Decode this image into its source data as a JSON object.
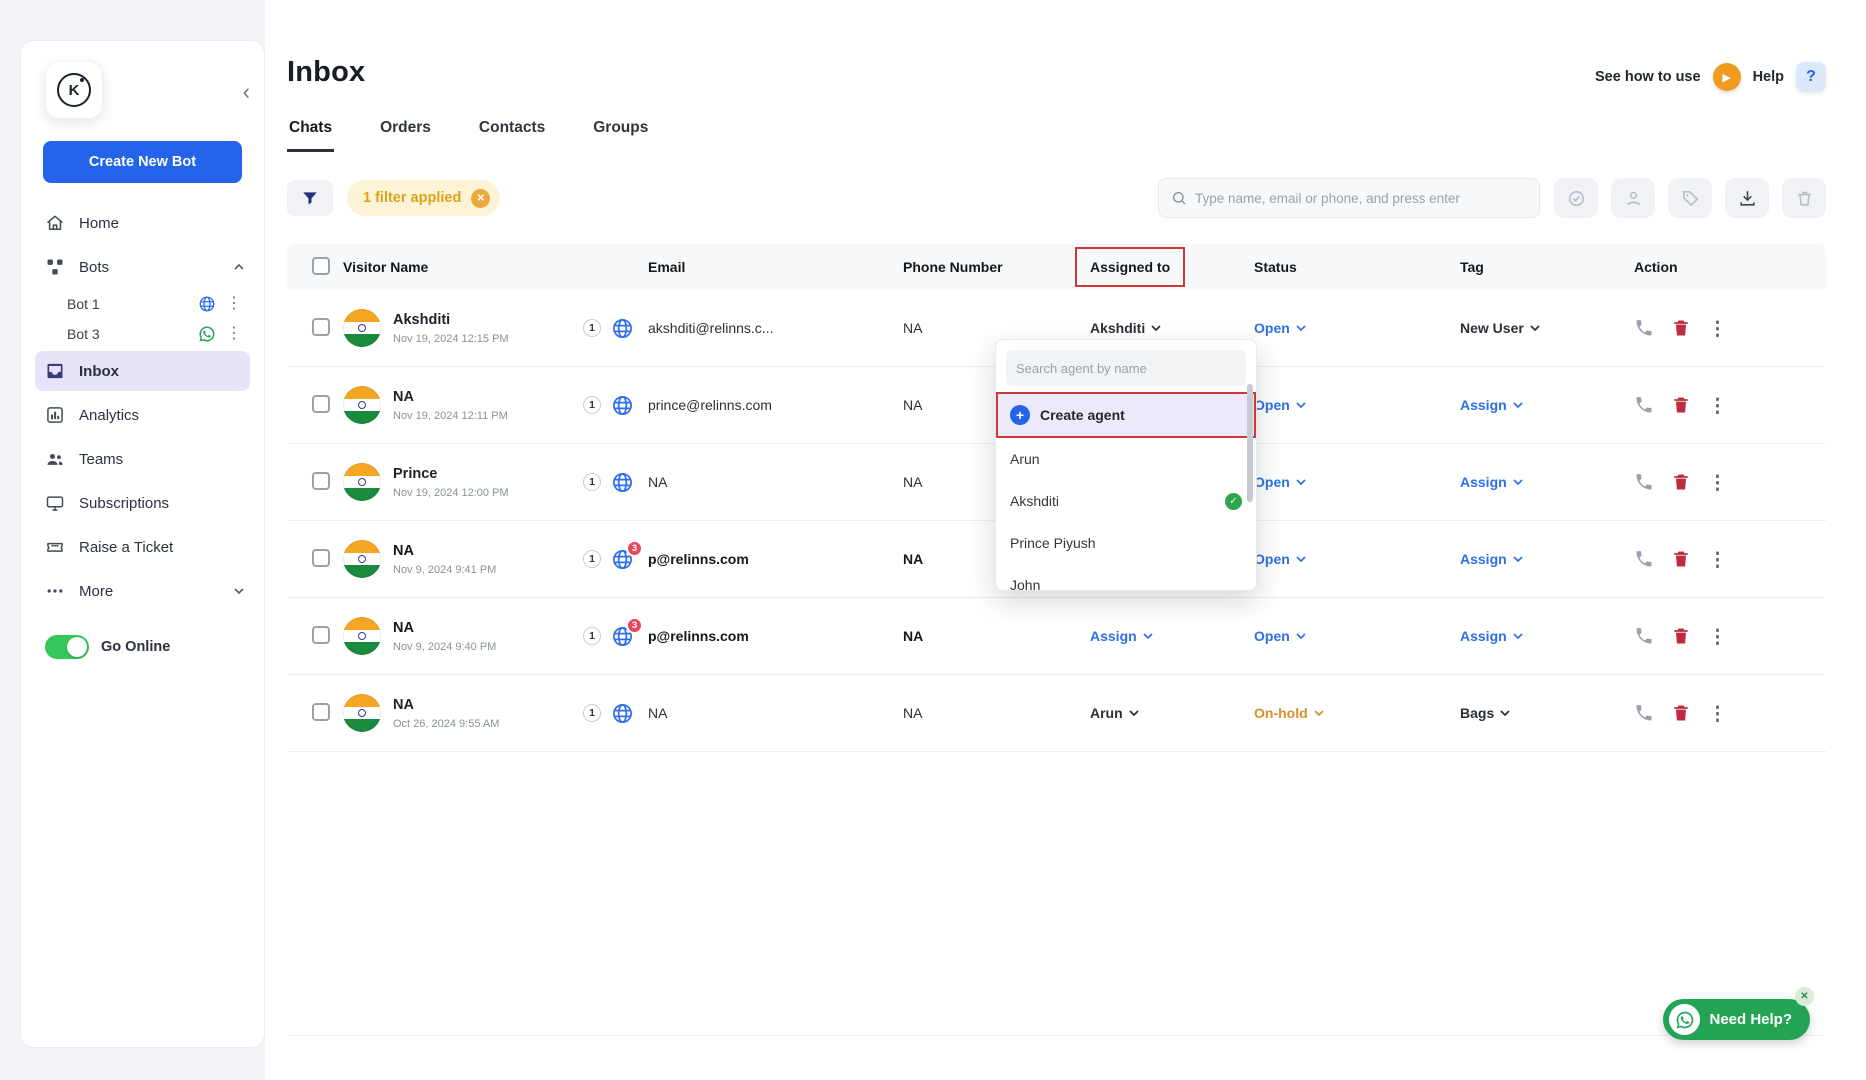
{
  "app": {
    "page_title": "Inbox",
    "see_how_to_use": "See how to use",
    "help_label": "Help",
    "need_help": "Need Help?"
  },
  "colors": {
    "accent_blue": "#2563eb",
    "link_blue": "#2e6fe7",
    "status_open": "#2e6fe7",
    "status_onhold": "#d78f2c",
    "danger_red": "#bf2b3e",
    "annotation_red": "#cc3b33",
    "whatsapp_green": "#23a455",
    "toggle_green": "#34c759",
    "filter_amber": "#d9a41b",
    "sidebar_active_bg": "#e7e3f8"
  },
  "sidebar": {
    "logo_letter": "K",
    "create_bot": "Create New Bot",
    "items": {
      "home": "Home",
      "bots": "Bots",
      "inbox": "Inbox",
      "analytics": "Analytics",
      "teams": "Teams",
      "subscriptions": "Subscriptions",
      "raise_ticket": "Raise a Ticket",
      "more": "More"
    },
    "bots": [
      {
        "name": "Bot 1",
        "channel": "web"
      },
      {
        "name": "Bot 3",
        "channel": "whatsapp"
      }
    ],
    "go_online": "Go Online"
  },
  "tabs": [
    {
      "label": "Chats",
      "active": true
    },
    {
      "label": "Orders",
      "active": false
    },
    {
      "label": "Contacts",
      "active": false
    },
    {
      "label": "Groups",
      "active": false
    }
  ],
  "toolbar": {
    "filter_applied": "1 filter applied",
    "search_placeholder": "Type name, email or phone, and press enter",
    "icon_names": [
      "filter-icon",
      "resolve-icon",
      "assign-agent-icon",
      "tag-icon",
      "download-icon",
      "delete-icon"
    ]
  },
  "table": {
    "columns": [
      "Visitor Name",
      "Email",
      "Phone Number",
      "Assigned to",
      "Status",
      "Tag",
      "Action"
    ],
    "annotated_column": "Assigned to",
    "rows": [
      {
        "name": "Akshditi",
        "date": "Nov 19, 2024 12:15 PM",
        "count": "1",
        "unread_badge": "",
        "email": "akshditi@relinns.c...",
        "phone": "NA",
        "assigned": "Akshditi",
        "assigned_style": "dark",
        "status": "Open",
        "status_style": "blue",
        "tag": "New User",
        "tag_style": "dark",
        "unread": false
      },
      {
        "name": "NA",
        "date": "Nov 19, 2024 12:11 PM",
        "count": "1",
        "unread_badge": "",
        "email": "prince@relinns.com",
        "phone": "NA",
        "assigned": "",
        "assigned_style": "blue",
        "status": "Open",
        "status_style": "blue",
        "tag": "Assign",
        "tag_style": "blue",
        "unread": false
      },
      {
        "name": "Prince",
        "date": "Nov 19, 2024 12:00 PM",
        "count": "1",
        "unread_badge": "",
        "email": "NA",
        "phone": "NA",
        "assigned": "",
        "assigned_style": "blue",
        "status": "Open",
        "status_style": "blue",
        "tag": "Assign",
        "tag_style": "blue",
        "unread": false
      },
      {
        "name": "NA",
        "date": "Nov 9, 2024 9:41 PM",
        "count": "1",
        "unread_badge": "3",
        "email": "p@relinns.com",
        "phone": "NA",
        "assigned": "",
        "assigned_style": "blue",
        "status": "Open",
        "status_style": "blue",
        "tag": "Assign",
        "tag_style": "blue",
        "unread": true
      },
      {
        "name": "NA",
        "date": "Nov 9, 2024 9:40 PM",
        "count": "1",
        "unread_badge": "3",
        "email": "p@relinns.com",
        "phone": "NA",
        "assigned": "Assign",
        "assigned_style": "blue",
        "status": "Open",
        "status_style": "blue",
        "tag": "Assign",
        "tag_style": "blue",
        "unread": true
      },
      {
        "name": "NA",
        "date": "Oct 26, 2024 9:55 AM",
        "count": "1",
        "unread_badge": "",
        "email": "NA",
        "phone": "NA",
        "assigned": "Arun",
        "assigned_style": "dark",
        "status": "On-hold",
        "status_style": "orange",
        "tag": "Bags",
        "tag_style": "dark",
        "unread": false
      }
    ]
  },
  "agent_dropdown": {
    "search_placeholder": "Search agent by name",
    "create_agent": "Create agent",
    "agents": [
      {
        "name": "Arun",
        "selected": false
      },
      {
        "name": "Akshditi",
        "selected": true
      },
      {
        "name": "Prince Piyush",
        "selected": false
      },
      {
        "name": "John",
        "selected": false
      }
    ]
  }
}
